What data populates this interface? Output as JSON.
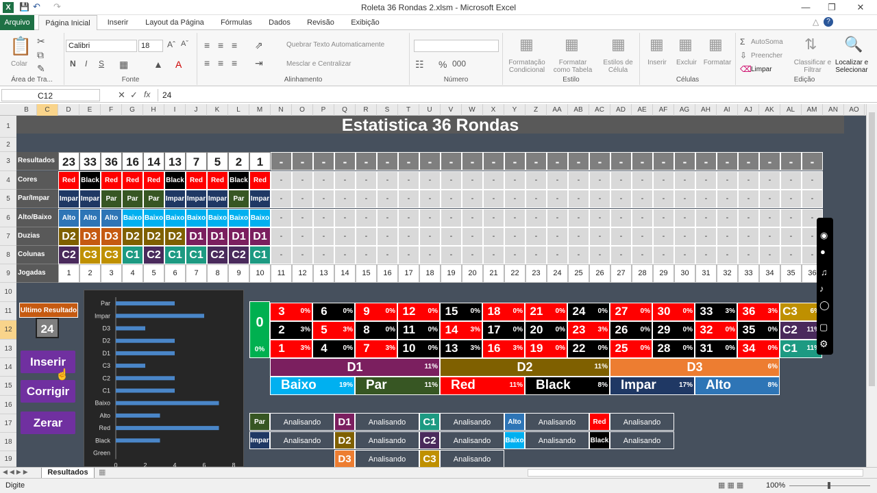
{
  "window": {
    "title": "Roleta 36 Rondas 2.xlsm  -  Microsoft Excel"
  },
  "tabs": [
    "Arquivo",
    "Página Inicial",
    "Inserir",
    "Layout da Página",
    "Fórmulas",
    "Dados",
    "Revisão",
    "Exibição"
  ],
  "ribbon": {
    "colar": "Colar",
    "area": "Área de Tra...",
    "fonte_label": "Fonte",
    "font_name": "Calibri",
    "font_size": "18",
    "quebrar": "Quebrar Texto Automaticamente",
    "mesclar": "Mesclar e Centralizar",
    "alinhamento_label": "Alinhamento",
    "numero_label": "Número",
    "formatacao": "Formatação Condicional",
    "formatar_tabela": "Formatar como Tabela",
    "estilos_celula": "Estilos de Célula",
    "estilo_label": "Estilo",
    "inserir": "Inserir",
    "excluir": "Excluir",
    "formatar": "Formatar",
    "celulas_label": "Células",
    "autosoma": "AutoSoma",
    "preencher": "Preencher",
    "limpar": "Limpar",
    "classificar": "Classificar e Filtrar",
    "localizar": "Localizar e Selecionar",
    "edicao_label": "Edição"
  },
  "formula": {
    "namebox": "C12",
    "fx": "fx",
    "value": "24"
  },
  "columns": [
    "B",
    "C",
    "D",
    "E",
    "F",
    "G",
    "H",
    "I",
    "J",
    "K",
    "L",
    "M",
    "N",
    "O",
    "P",
    "Q",
    "R",
    "S",
    "T",
    "U",
    "V",
    "W",
    "X",
    "Y",
    "Z",
    "AA",
    "AB",
    "AC",
    "AD",
    "AE",
    "AF",
    "AG",
    "AH",
    "AI",
    "AJ",
    "AK",
    "AL",
    "AM",
    "AN",
    "AO"
  ],
  "rows": [
    "1",
    "2",
    "3",
    "4",
    "5",
    "6",
    "7",
    "8",
    "9",
    "10",
    "11",
    "12",
    "13",
    "14",
    "15",
    "16",
    "17",
    "18",
    "19"
  ],
  "sheet": {
    "title": "Estatistica 36 Rondas",
    "labels": [
      "Resultados",
      "Cores",
      "Par/Impar",
      "Alto/Baixo",
      "Duzias",
      "Colunas",
      "Jogadas"
    ],
    "resultados": [
      "23",
      "33",
      "36",
      "16",
      "14",
      "13",
      "7",
      "5",
      "2",
      "1"
    ],
    "cores": [
      "Red",
      "Black",
      "Red",
      "Red",
      "Red",
      "Black",
      "Red",
      "Red",
      "Black",
      "Red"
    ],
    "parimpar": [
      "Impar",
      "Impar",
      "Par",
      "Par",
      "Par",
      "Impar",
      "Impar",
      "Impar",
      "Par",
      "Impar"
    ],
    "altobaixo": [
      "Alto",
      "Alto",
      "Alto",
      "Baixo",
      "Baixo",
      "Baixo",
      "Baixo",
      "Baixo",
      "Baixo",
      "Baixo"
    ],
    "duzias": [
      "D2",
      "D3",
      "D3",
      "D2",
      "D2",
      "D2",
      "D1",
      "D1",
      "D1",
      "D1"
    ],
    "colunas": [
      "C2",
      "C3",
      "C3",
      "C1",
      "C2",
      "C1",
      "C1",
      "C2",
      "C2",
      "C1"
    ],
    "dash": "-",
    "jogadas": [
      "1",
      "2",
      "3",
      "4",
      "5",
      "6",
      "7",
      "8",
      "9",
      "10",
      "11",
      "12",
      "13",
      "14",
      "15",
      "16",
      "17",
      "18",
      "19",
      "20",
      "21",
      "22",
      "23",
      "24",
      "25",
      "26",
      "27",
      "28",
      "29",
      "30",
      "31",
      "32",
      "33",
      "34",
      "35",
      "36"
    ],
    "ultimo_label": "Ultimo Resultado",
    "ultimo_value": "24",
    "buttons": {
      "inserir": "Inserir",
      "corrigir": "Corrigir",
      "zerar": "Zerar"
    },
    "zero": {
      "num": "0",
      "pct": "0%"
    },
    "board": [
      [
        [
          "3",
          "0%",
          "r"
        ],
        [
          "6",
          "0%",
          "b"
        ],
        [
          "9",
          "0%",
          "r"
        ],
        [
          "12",
          "0%",
          "r"
        ],
        [
          "15",
          "0%",
          "b"
        ],
        [
          "18",
          "0%",
          "r"
        ],
        [
          "21",
          "0%",
          "r"
        ],
        [
          "24",
          "0%",
          "b"
        ],
        [
          "27",
          "0%",
          "r"
        ],
        [
          "30",
          "0%",
          "r"
        ],
        [
          "33",
          "3%",
          "b"
        ],
        [
          "36",
          "3%",
          "r"
        ]
      ],
      [
        [
          "2",
          "3%",
          "b"
        ],
        [
          "5",
          "3%",
          "r"
        ],
        [
          "8",
          "0%",
          "b"
        ],
        [
          "11",
          "0%",
          "b"
        ],
        [
          "14",
          "3%",
          "r"
        ],
        [
          "17",
          "0%",
          "b"
        ],
        [
          "20",
          "0%",
          "b"
        ],
        [
          "23",
          "3%",
          "r"
        ],
        [
          "26",
          "0%",
          "b"
        ],
        [
          "29",
          "0%",
          "b"
        ],
        [
          "32",
          "0%",
          "r"
        ],
        [
          "35",
          "0%",
          "b"
        ]
      ],
      [
        [
          "1",
          "3%",
          "r"
        ],
        [
          "4",
          "0%",
          "b"
        ],
        [
          "7",
          "3%",
          "r"
        ],
        [
          "10",
          "0%",
          "b"
        ],
        [
          "13",
          "3%",
          "b"
        ],
        [
          "16",
          "3%",
          "r"
        ],
        [
          "19",
          "0%",
          "r"
        ],
        [
          "22",
          "0%",
          "b"
        ],
        [
          "25",
          "0%",
          "r"
        ],
        [
          "28",
          "0%",
          "b"
        ],
        [
          "31",
          "0%",
          "b"
        ],
        [
          "34",
          "0%",
          "r"
        ]
      ]
    ],
    "colstats": [
      [
        "C3",
        "6%"
      ],
      [
        "C2",
        "11%"
      ],
      [
        "C1",
        "11%"
      ]
    ],
    "dozens": [
      [
        "D1",
        "11%"
      ],
      [
        "D2",
        "11%"
      ],
      [
        "D3",
        "6%"
      ]
    ],
    "outside": [
      [
        "Baixo",
        "19%"
      ],
      [
        "Par",
        "11%"
      ],
      [
        "Red",
        "11%"
      ],
      [
        "Black",
        "8%"
      ],
      [
        "Impar",
        "17%"
      ],
      [
        "Alto",
        "8%"
      ]
    ],
    "analysis_text": "Analisando",
    "analysis": [
      [
        "Par",
        "D1",
        "C1",
        "Alto",
        "Red"
      ],
      [
        "Impar",
        "D2",
        "C2",
        "Baixo",
        "Black"
      ],
      [
        "D3",
        "C3"
      ]
    ]
  },
  "chart_data": {
    "type": "bar",
    "orientation": "horizontal",
    "categories": [
      "Par",
      "Impar",
      "D3",
      "D2",
      "D1",
      "C3",
      "C2",
      "C1",
      "Baixo",
      "Alto",
      "Red",
      "Black",
      "Green"
    ],
    "values": [
      4,
      6,
      2,
      4,
      4,
      2,
      4,
      4,
      7,
      3,
      7,
      3,
      0
    ],
    "xlim": [
      0,
      8
    ],
    "xticks": [
      "0",
      "2",
      "4",
      "6",
      "8"
    ],
    "color": "#4a86c8"
  },
  "sheet_tab": "Resultados",
  "status": {
    "left": "Digite",
    "zoom": "100%"
  }
}
